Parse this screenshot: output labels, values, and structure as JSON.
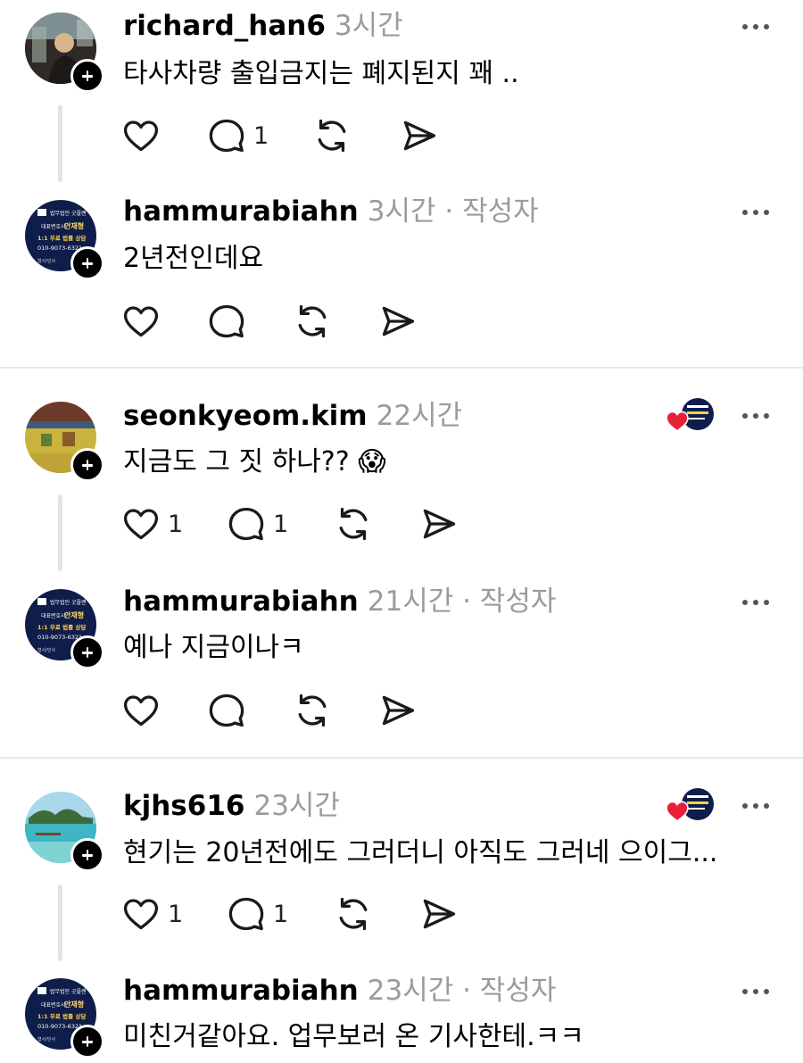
{
  "posts": [
    {
      "username": "richard_han6",
      "meta": "3시간",
      "text": "타사차량 출입금지는 폐지된지 꽤 ..",
      "like_count": "",
      "reply_count": "1"
    },
    {
      "username": "hammurabiahn",
      "meta": "3시간 · 작성자",
      "text": "2년전인데요",
      "like_count": "",
      "reply_count": ""
    },
    {
      "username": "seonkyeom.kim",
      "meta": "22시간",
      "text": "지금도 그 짓 하나?? 😱",
      "like_count": "1",
      "reply_count": "1"
    },
    {
      "username": "hammurabiahn",
      "meta": "21시간 · 작성자",
      "text": "예나 지금이나ㅋ",
      "like_count": "",
      "reply_count": ""
    },
    {
      "username": "kjhs616",
      "meta": "23시간",
      "text": "현기는 20년전에도 그러더니 아직도 그러네 으이그...",
      "like_count": "1",
      "reply_count": "1"
    },
    {
      "username": "hammurabiahn",
      "meta": "23시간 · 작성자",
      "text": "미친거같아요. 업무보러 온 기사한테.ㅋㅋ",
      "like_count": "",
      "reply_count": ""
    }
  ],
  "lawyer_avatar": {
    "firm": "법무법인 굿플랜",
    "title": "대표변호사",
    "name": "안재형",
    "consult": "1:1 무료 법률 상담",
    "phone": "010-9073-6321",
    "fields": "형사/민사"
  },
  "colors": {
    "meta_gray": "#9b9b9b",
    "heart_red": "#e8203a",
    "divider": "#e9e9e9",
    "thread_line": "#e3e3e3"
  },
  "icons": [
    "heart-icon",
    "comment-icon",
    "repost-icon",
    "share-icon",
    "more-icon",
    "follow-plus-icon",
    "liked-heart-icon"
  ]
}
